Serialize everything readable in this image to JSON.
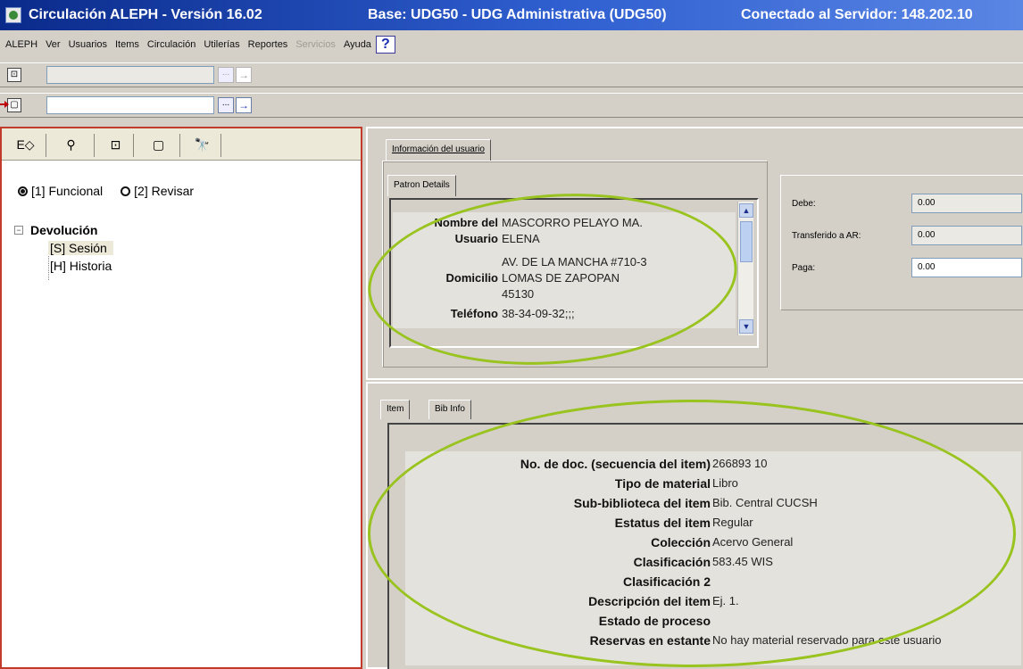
{
  "window": {
    "title": "Circulación ALEPH - Versión 16.02",
    "base": "Base: UDG50 - UDG Administrativa (UDG50)",
    "server": "Conectado al Servidor: 148.202.10"
  },
  "menu": {
    "items": [
      "ALEPH",
      "Ver",
      "Usuarios",
      "Items",
      "Circulación",
      "Utilerías",
      "Reportes",
      "Servicios",
      "Ayuda"
    ],
    "help_label": "?"
  },
  "toolbar": {
    "row1_value": "",
    "row2_value": "",
    "dots": "...",
    "go": "→"
  },
  "left_panel": {
    "tabs": [
      "E◇",
      "⚲",
      "⊡",
      "▢",
      "🔭"
    ],
    "radio_options": [
      "[1] Funcional",
      "[2] Revisar"
    ],
    "selected_radio": 0,
    "tree_root": "Devolución",
    "tree_children": [
      "[S] Sesión",
      "[H] Historia"
    ],
    "expander": "−"
  },
  "user_info": {
    "tab_label": "Información del usuario",
    "patron_tab": "Patron Details",
    "rows": [
      {
        "label": "Nombre del",
        "value": "MASCORRO PELAYO MA."
      },
      {
        "label": "Usuario",
        "value": "ELENA"
      },
      {
        "label": "",
        "value": "AV. DE LA MANCHA #710-3"
      },
      {
        "label": "Domicilio",
        "value": "LOMAS DE ZAPOPAN"
      },
      {
        "label": "",
        "value": "45130"
      },
      {
        "label": "Teléfono",
        "value": "38-34-09-32;;;"
      }
    ],
    "finance": [
      {
        "label": "Debe:",
        "value": "0.00"
      },
      {
        "label": "Transferido a AR:",
        "value": "0.00"
      },
      {
        "label": "Paga:",
        "value": "0.00"
      }
    ]
  },
  "item_panel": {
    "tabs": [
      "Item",
      "Bib Info"
    ],
    "rows": [
      {
        "label": "No. de doc. (secuencia del item)",
        "value": "266893 10"
      },
      {
        "label": "Tipo de material",
        "value": "Libro"
      },
      {
        "label": "Sub-biblioteca del item",
        "value": "Bib. Central CUCSH"
      },
      {
        "label": "Estatus del item",
        "value": "Regular"
      },
      {
        "label": "Colección",
        "value": "Acervo General"
      },
      {
        "label": "Clasificación",
        "value": "583.45 WIS"
      },
      {
        "label": "Clasificación 2",
        "value": ""
      },
      {
        "label": "Descripción del item",
        "value": "Ej. 1."
      },
      {
        "label": "Estado de proceso",
        "value": ""
      },
      {
        "label": "Reservas en estante",
        "value": "No hay material reservado para este usuario"
      }
    ]
  },
  "colors": {
    "title_bar": "#0a2a8a",
    "highlight_ellipse": "#99c31e",
    "panel_border": "#c23a2a"
  }
}
